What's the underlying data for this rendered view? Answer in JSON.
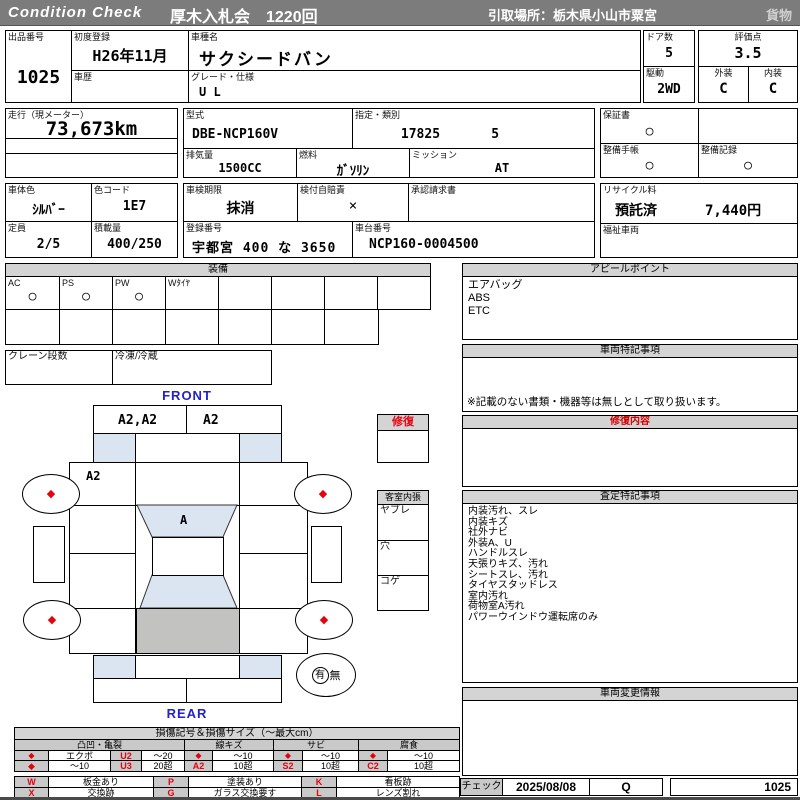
{
  "header": {
    "brand": "Condition  Check",
    "auction": "厚木入札会　1220回",
    "pickup": "引取場所：栃木県小山市粟宮",
    "category": "貨物"
  },
  "info": {
    "exhibit_no_label": "出品番号",
    "exhibit_no": "1025",
    "first_reg_label": "初度登録",
    "first_reg": "H26年11月",
    "history_label": "車歴",
    "model_name_label": "車種名",
    "model_name": "サクシードバン",
    "grade_label": "グレード・仕様",
    "grade": "U L",
    "doors_label": "ドア数",
    "doors": "5",
    "drive_label": "駆動",
    "drive": "2WD",
    "score_label": "評価点",
    "score": "3.5",
    "exterior_label": "外装",
    "exterior": "C",
    "interior_label": "内装",
    "interior": "C",
    "mileage_label": "走行（現メーター）",
    "mileage": "73,673km",
    "model_code_label": "型式",
    "model_code": "DBE-NCP160V",
    "class_label": "指定・類別",
    "class_no": "17825",
    "class_sub": "5",
    "displacement_label": "排気量",
    "displacement": "1500CC",
    "fuel_label": "燃料",
    "fuel": "ｶﾞｿﾘﾝ",
    "mission_label": "ミッション",
    "mission": "AT",
    "warranty_label": "保証書",
    "warranty": "○",
    "maintenance_book_label": "整備手帳",
    "maintenance_book": "○",
    "maintenance_record_label": "整備記録",
    "maintenance_record": "○",
    "body_color_label": "車体色",
    "body_color": "ｼﾙﾊﾞｰ",
    "color_code_label": "色コード",
    "color_code": "1E7",
    "inspection_label": "車検期限",
    "inspection": "抹消",
    "insurance_label": "検付自賠責",
    "insurance": "×",
    "approval_label": "承認請求書",
    "capacity_label": "定員",
    "capacity": "2/5",
    "load_label": "積載量",
    "load": "400/250",
    "reg_no_label": "登録番号",
    "reg_no": "宇都宮 400 な 3650",
    "chassis_label": "車台番号",
    "chassis_no": "NCP160-0004500",
    "recycle_label": "リサイクル料",
    "recycle_status": "預託済",
    "recycle_fee": "7,440円",
    "welfare_label": "福祉車両"
  },
  "equipment": {
    "title": "装備",
    "items": [
      {
        "label": "AC",
        "value": "○"
      },
      {
        "label": "PS",
        "value": "○"
      },
      {
        "label": "PW",
        "value": "○"
      },
      {
        "label": "Wﾀｲﾔ",
        "value": ""
      }
    ],
    "crane_label": "クレーン段数",
    "reefer_label": "冷凍/冷蔵"
  },
  "diagram": {
    "front_label": "FRONT",
    "rear_label": "REAR",
    "bumper_front_left": "A2,A2",
    "bumper_front_right": "A2",
    "body_left": "A2",
    "windshield": "A",
    "wheel_mark": "◆",
    "repair_label": "修復",
    "lining_label": "客室内張",
    "lining_items": [
      "ヤブレ",
      "穴",
      "コゲ"
    ],
    "spare_yes": "有",
    "spare_no": "無"
  },
  "right": {
    "appeal_title": "アピールポイント",
    "appeal_items": [
      "エアバッグ",
      "ABS",
      "ETC"
    ],
    "special_title": "車両特記事項",
    "special_note": "※記載のない書類・機器等は無しとして取り扱います。",
    "repair_title": "修復内容",
    "assess_title": "査定特記事項",
    "assess_items": [
      "内装汚れ、スレ",
      "内装キズ",
      "社外ナビ",
      "外装A、U",
      "ハンドルスレ",
      "天張りキズ、汚れ",
      "シートスレ、汚れ",
      "タイヤスタッドレス",
      "室内汚れ",
      "荷物室A汚れ",
      "パワーウインドウ運転席のみ"
    ],
    "change_title": "車両変更情報",
    "check_label": "チェック",
    "check_date": "2025/08/08",
    "check_code": "Q",
    "check_no": "1025"
  },
  "legend": {
    "title": "損傷記号＆損傷サイズ（～最大cm）",
    "groups": [
      "凸凹・亀裂",
      "線キズ",
      "サビ",
      "腐食"
    ],
    "row1": [
      "◆",
      "エクボ",
      "U2",
      "～20",
      "◆",
      "～10",
      "◆",
      "～10",
      "◆",
      "～10"
    ],
    "row2": [
      "◆",
      "～10",
      "U3",
      "20超",
      "A2",
      "10超",
      "S2",
      "10超",
      "C2",
      "10超"
    ],
    "codes1": [
      "W",
      "板金あり",
      "P",
      "塗装あり",
      "K",
      "看板跡"
    ],
    "codes2": [
      "X",
      "交換跡",
      "G",
      "ガラス交換要す",
      "L",
      "レンズ割れ"
    ]
  },
  "colors": {
    "header_bg": "#7c7c7c",
    "section_bg": "#d4d4d4",
    "accent_red": "#e8000d",
    "accent_blue": "#2222cc",
    "light_blue_fill": "#dbe5f1",
    "cargo_gray": "#c2c2c0"
  }
}
